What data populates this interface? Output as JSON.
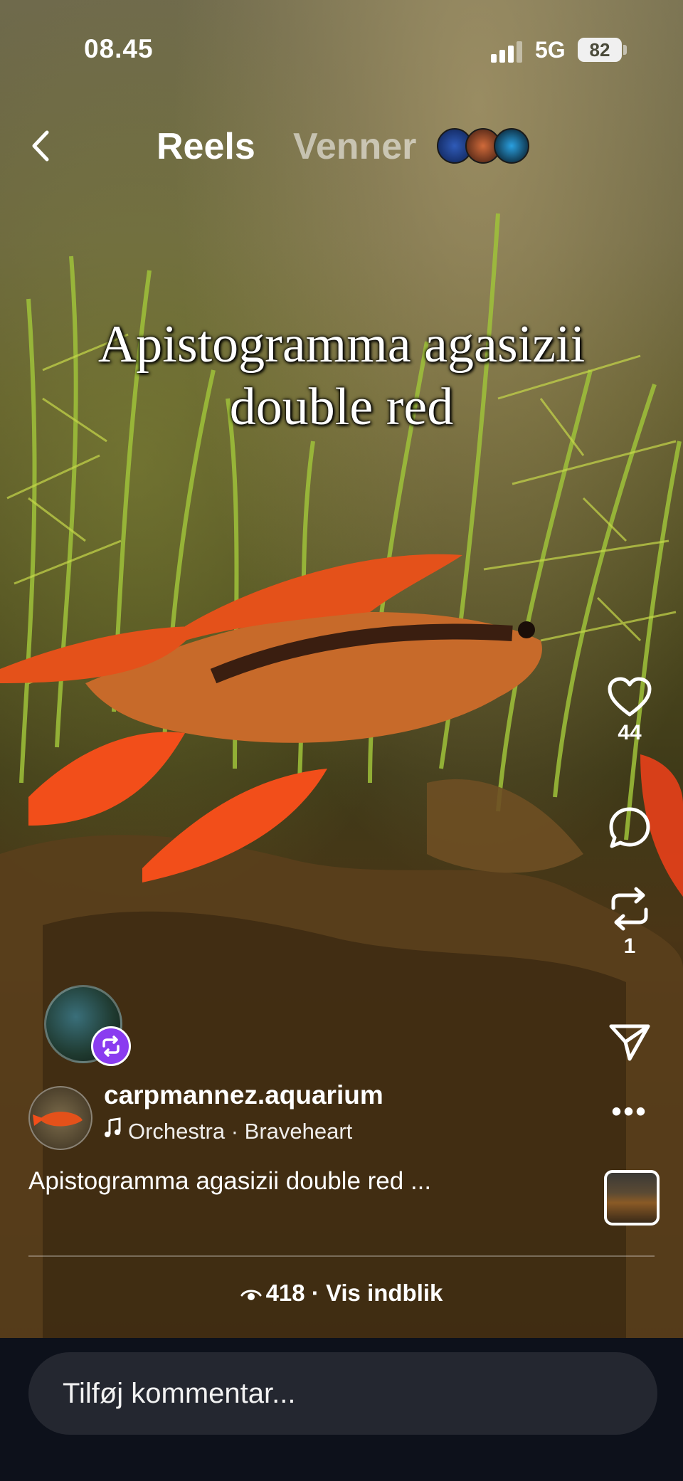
{
  "status_bar": {
    "time": "08.45",
    "network": "5G",
    "battery": "82"
  },
  "header": {
    "tab_reels": "Reels",
    "tab_friends": "Venner"
  },
  "video": {
    "overlay_title": "Apistogramma agasizii\ndouble red"
  },
  "actions": {
    "likes": "44",
    "reposts": "1"
  },
  "post": {
    "username": "carpmannez.aquarium",
    "music": "Orchestra · Braveheart",
    "caption": "Apistogramma agasizii double red ...",
    "views": "418",
    "insights_label": "Vis indblik"
  },
  "comment": {
    "placeholder": "Tilføj kommentar..."
  },
  "icons": [
    "back-icon",
    "like-icon",
    "comment-icon",
    "repost-icon",
    "share-icon",
    "more-icon",
    "music-note-icon",
    "eye-icon"
  ],
  "colors": {
    "accent_purple": "#8a3cf0",
    "comment_bar": "#0d111b",
    "comment_box": "#242730"
  }
}
